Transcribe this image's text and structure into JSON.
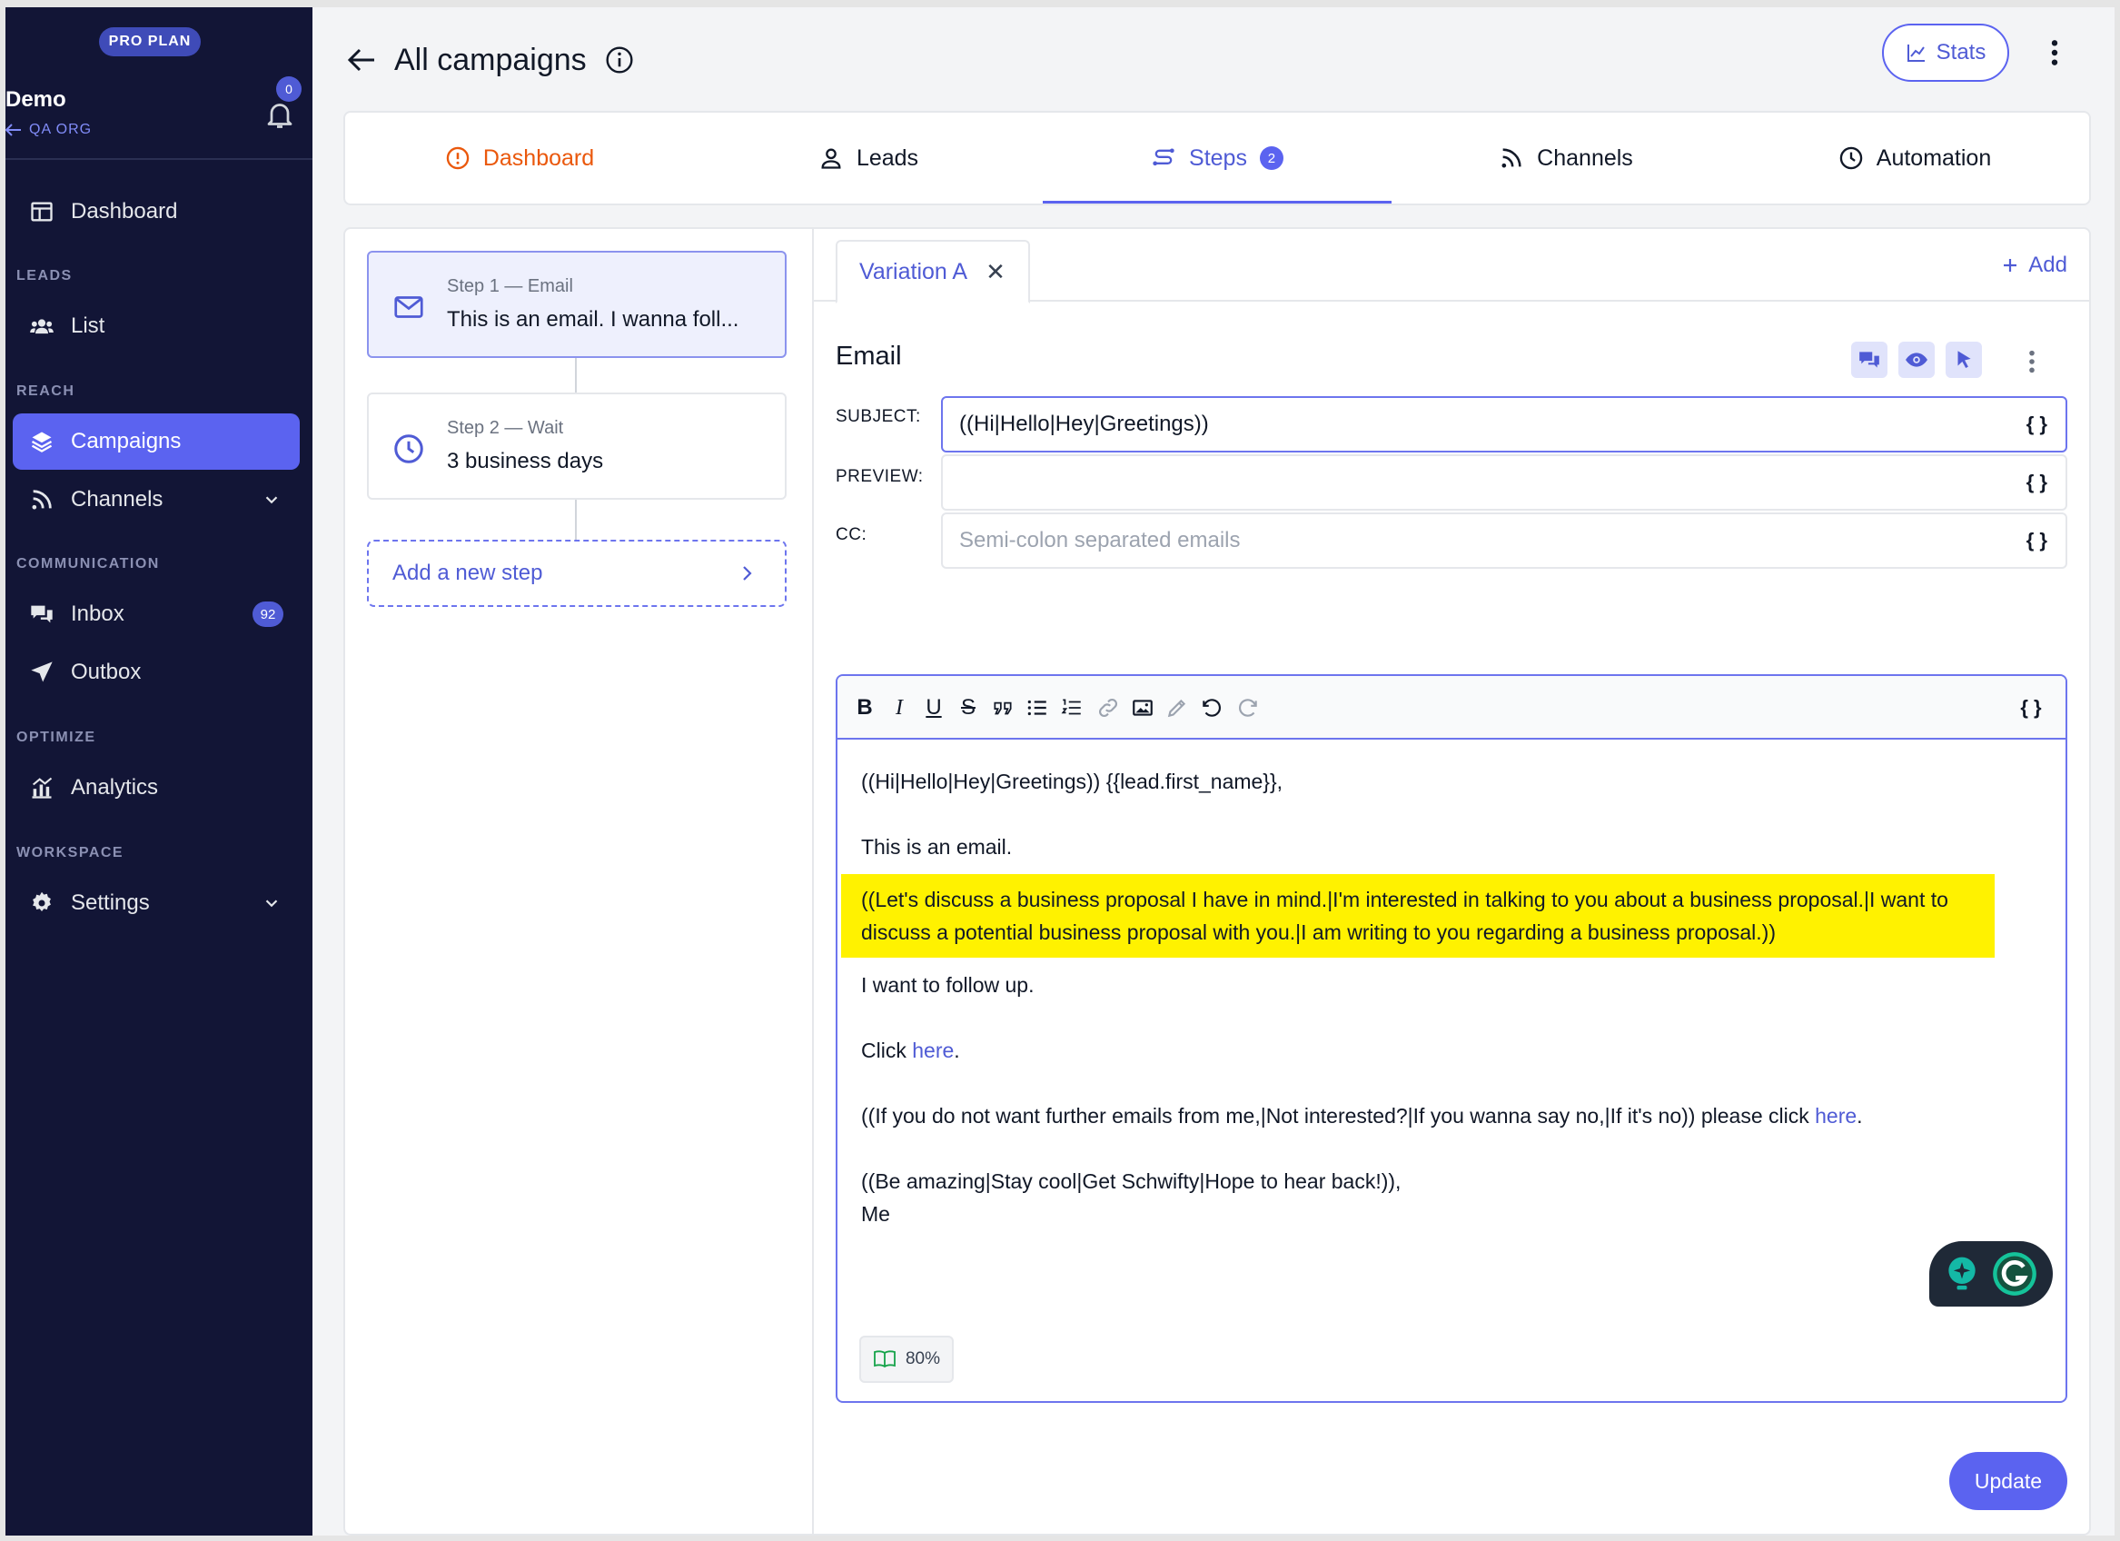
{
  "sidebar": {
    "plan_badge": "PRO PLAN",
    "org_name": "Demo",
    "org_sub": "QA ORG",
    "notifications_count": "0",
    "sections": {
      "leads": "LEADS",
      "reach": "REACH",
      "communication": "COMMUNICATION",
      "optimize": "OPTIMIZE",
      "workspace": "WORKSPACE"
    },
    "items": {
      "dashboard": "Dashboard",
      "list": "List",
      "campaigns": "Campaigns",
      "channels": "Channels",
      "inbox": "Inbox",
      "inbox_count": "92",
      "outbox": "Outbox",
      "analytics": "Analytics",
      "settings": "Settings"
    }
  },
  "header": {
    "title": "All campaigns",
    "stats_label": "Stats"
  },
  "tabs": {
    "dashboard": "Dashboard",
    "leads": "Leads",
    "steps": "Steps",
    "steps_count": "2",
    "channels": "Channels",
    "automation": "Automation",
    "active": "steps"
  },
  "steps": [
    {
      "label": "Step 1 — Email",
      "text": "This is an email. I wanna foll..."
    },
    {
      "label": "Step 2 — Wait",
      "text": "3 business days"
    }
  ],
  "add_step_label": "Add a new step",
  "variation": {
    "tab_label": "Variation A",
    "add_label": "Add"
  },
  "email": {
    "title": "Email",
    "subject_label": "SUBJECT:",
    "subject_value": "((Hi|Hello|Hey|Greetings))",
    "preview_label": "PREVIEW:",
    "preview_value": "",
    "cc_label": "CC:",
    "cc_placeholder": "Semi-colon separated emails",
    "brace_symbol": "{ }",
    "body": {
      "line1": "((Hi|Hello|Hey|Greetings)) {{lead.first_name}},",
      "line2": "This is an email.",
      "highlight": "((Let's discuss a business proposal I have in mind.|I'm interested in talking to you about a business proposal.|I want to discuss a potential business proposal with you.|I am writing to you regarding a business proposal.))",
      "line3": "I want to follow up.",
      "click_prefix": "Click ",
      "click_link": "here",
      "click_suffix": ".",
      "unsub_text": "((If you do not want further emails from me,|Not interested?|If you wanna say no,|If it's no)) please click ",
      "unsub_link": "here",
      "unsub_suffix": ".",
      "signoff": "((Be amazing|Stay cool|Get Schwifty|Hope to hear back!)),",
      "signature": "Me"
    },
    "readability": "80%",
    "update_label": "Update"
  },
  "colors": {
    "sidebar_bg": "#121536",
    "accent": "#5b63f0",
    "highlight": "#fff200",
    "dashboard_tab": "#ea580c"
  }
}
